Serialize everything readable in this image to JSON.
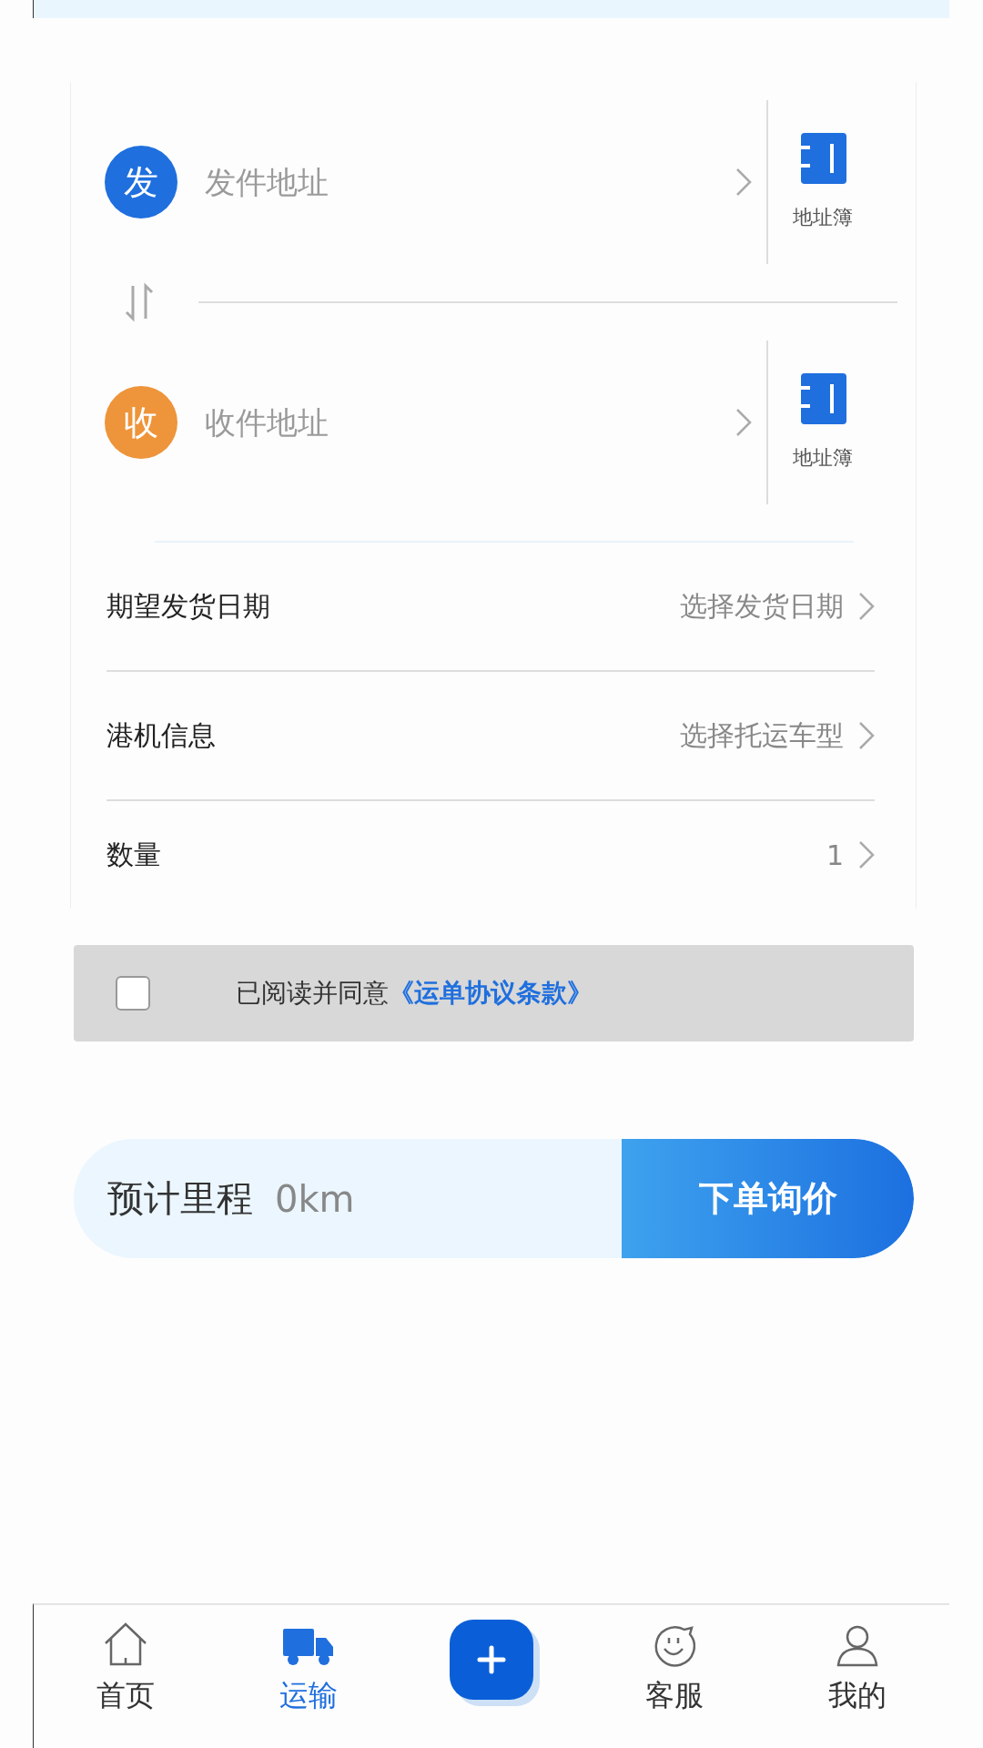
{
  "addresses": [
    {
      "badge": "发",
      "color": "#1f6fde",
      "placeholder": "发件地址",
      "book_label": "地址簿"
    },
    {
      "badge": "收",
      "color": "#ee943a",
      "placeholder": "收件地址",
      "book_label": "地址簿"
    }
  ],
  "fields": [
    {
      "label": "期望发货日期",
      "value": "选择发货日期"
    },
    {
      "label": "港机信息",
      "value": "选择托运车型"
    },
    {
      "label": "数量",
      "value": "1"
    }
  ],
  "agreement": {
    "checked": false,
    "text": "已阅读并同意",
    "link": "《运单协议条款》"
  },
  "estimate": {
    "label": "预计里程",
    "value": "0km",
    "button": "下单询价"
  },
  "tabbar": [
    {
      "kind": "home",
      "label": "首页",
      "selected": false
    },
    {
      "kind": "transport",
      "label": "运输",
      "selected": true
    },
    {
      "kind": "add",
      "selected": false
    },
    {
      "kind": "service",
      "label": "客服",
      "selected": false
    },
    {
      "kind": "profile",
      "label": "我的",
      "selected": false
    }
  ]
}
